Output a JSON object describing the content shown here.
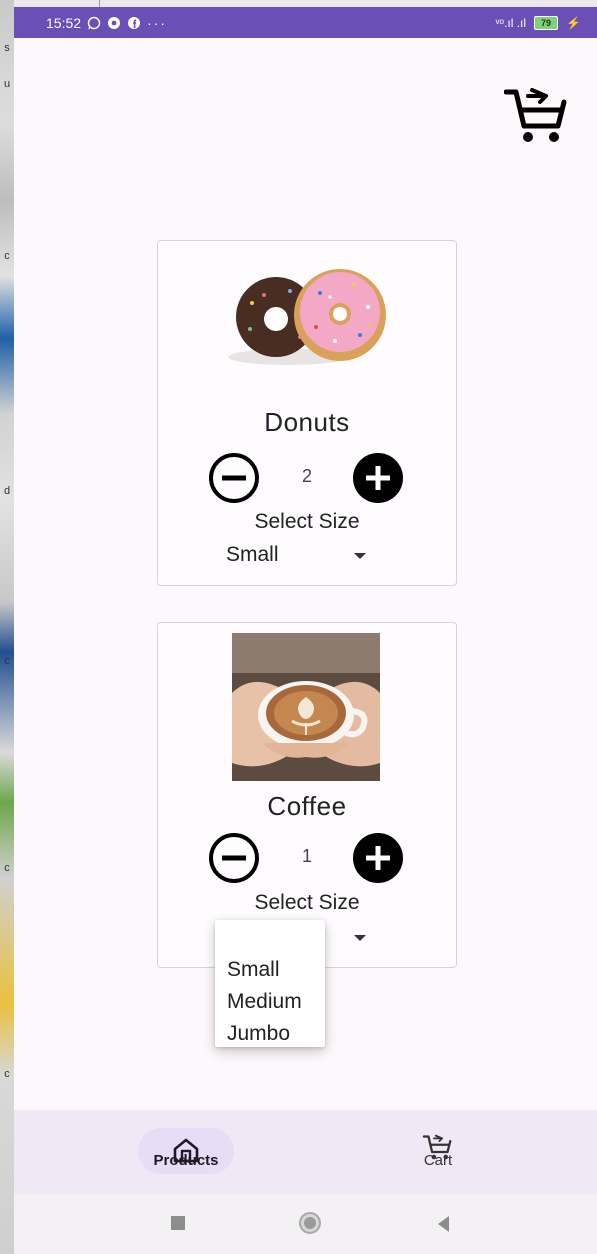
{
  "status_bar": {
    "time": "15:52",
    "signal_text": "ᵛᵒ.ıl .ıl",
    "battery_level": "79"
  },
  "products": [
    {
      "name": "Donuts",
      "quantity": "2",
      "size_label": "Select Size",
      "selected_size": "Small"
    },
    {
      "name": "Coffee",
      "quantity": "1",
      "size_label": "Select Size",
      "selected_size": ""
    }
  ],
  "size_menu": {
    "options": [
      "Small",
      "Medium",
      "Jumbo"
    ]
  },
  "bottom_nav": {
    "products_label": "Products",
    "cart_label": "Cart"
  },
  "colors": {
    "status_bar": "#6a4fb6",
    "background": "#fcf8fb",
    "nav_bar": "#f0e8f4",
    "nav_pill": "#e8dcf7"
  }
}
